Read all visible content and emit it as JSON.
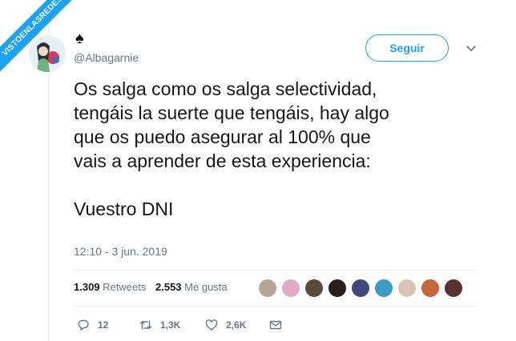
{
  "watermark": "VISTOENLASREDES",
  "user": {
    "display_name": "♠",
    "handle": "@Albagarnie"
  },
  "follow_label": "Seguir",
  "tweet": {
    "text": "Os salga como os salga selectividad,\ntengáis la suerte que tengáis, hay algo\nque os puedo asegurar al 100% que\nvais a aprender de esta experiencia:\n\nVuestro DNI",
    "timestamp": "12:10 - 3 jun. 2019"
  },
  "stats": {
    "retweets_count": "1.309",
    "retweets_label": "Retweets",
    "likes_count": "2.553",
    "likes_label": "Me gusta"
  },
  "liker_colors": [
    "#b8a59a",
    "#e3a9c2",
    "#5a4a3a",
    "#2a1e1a",
    "#3b4a7a",
    "#3a9bc2",
    "#d8c4b4",
    "#c8643a",
    "#5a3030"
  ],
  "actions": {
    "replies": "12",
    "retweets": "1,3K",
    "likes": "2,6K"
  },
  "icons": {
    "reply": "reply-icon",
    "retweet": "retweet-icon",
    "like": "heart-icon",
    "dm": "mail-icon",
    "caret": "chevron-down-icon"
  }
}
